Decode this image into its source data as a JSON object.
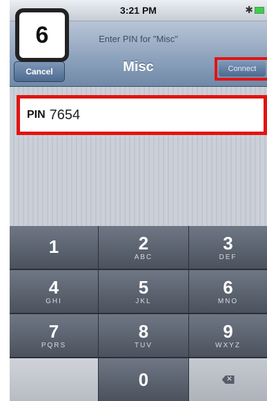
{
  "step_badge": "6",
  "status_bar": {
    "time": "3:21 PM"
  },
  "nav": {
    "prompt": "Enter PIN for \"Misc\"",
    "title": "Misc",
    "cancel_label": "Cancel",
    "connect_label": "Connect"
  },
  "pin_field": {
    "label": "PIN",
    "value": "7654"
  },
  "keypad": [
    {
      "digit": "1",
      "letters": ""
    },
    {
      "digit": "2",
      "letters": "ABC"
    },
    {
      "digit": "3",
      "letters": "DEF"
    },
    {
      "digit": "4",
      "letters": "GHI"
    },
    {
      "digit": "5",
      "letters": "JKL"
    },
    {
      "digit": "6",
      "letters": "MNO"
    },
    {
      "digit": "7",
      "letters": "PQRS"
    },
    {
      "digit": "8",
      "letters": "TUV"
    },
    {
      "digit": "9",
      "letters": "WXYZ"
    },
    {
      "digit": "0",
      "letters": ""
    }
  ],
  "colors": {
    "highlight": "#e21313",
    "nav": "#8ea3bd"
  }
}
